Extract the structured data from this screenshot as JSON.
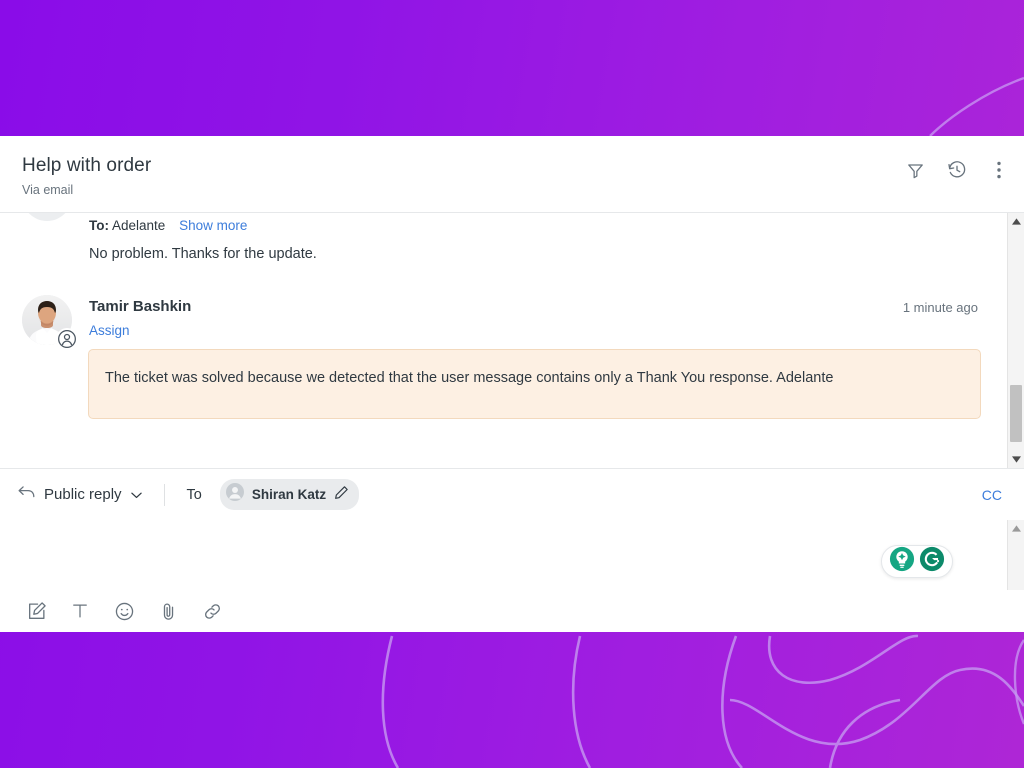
{
  "theme": {
    "bg_gradient_from": "#8A0CE8",
    "bg_gradient_to": "#AE26D6",
    "card_bg": "#FFFFFF",
    "link_color": "#3D7DDB",
    "text_primary": "#2F3941",
    "text_secondary": "#68737D",
    "note_bg": "#FDF0E3",
    "note_border": "#F3D9BD",
    "chip_bg": "#E9EBED",
    "grammarly_green": "#15A683",
    "grammarly_dark_green": "#0C8A6A"
  },
  "header": {
    "title": "Help with order",
    "subtitle": "Via email",
    "actions": [
      {
        "name": "filter-icon",
        "label": "Filter"
      },
      {
        "name": "history-icon",
        "label": "History"
      },
      {
        "name": "more-options-icon",
        "label": "More options"
      }
    ]
  },
  "conversation": {
    "messages": [
      {
        "id": "clipped-message",
        "to_label": "To:",
        "to_value": "Adelante",
        "show_more_label": "Show more",
        "body": "No problem. Thanks for the update."
      },
      {
        "id": "internal-note",
        "author": "Tamir Bashkin",
        "assign_label": "Assign",
        "timestamp": "1 minute ago",
        "note_body": "The ticket was solved because we detected that the user message contains only a Thank You response. Adelante"
      }
    ],
    "scrollbar": {
      "up_arrow": "▲",
      "down_arrow": "▼",
      "thumb_top_pct": 70,
      "thumb_height_pct": 26
    }
  },
  "reply": {
    "reply_icon": "reply-arrow-icon",
    "type_label": "Public reply",
    "chevron": "⌄",
    "to_label": "To",
    "recipient": {
      "name": "Shiran Katz",
      "avatar_icon": "person-avatar-icon",
      "edit_icon": "pencil-edit-icon"
    },
    "cc_label": "CC",
    "composer_placeholder": "",
    "composer_value": "",
    "scrollbar": {
      "up_arrow": "▲",
      "down_arrow": "▼"
    }
  },
  "grammarly": {
    "assistant_icon": "lightbulb-sparkle-icon",
    "logo_letter": "G",
    "logo_icon": "grammarly-logo-icon"
  },
  "format_toolbar": {
    "items": [
      {
        "name": "compose-edit-icon",
        "label": "Compose"
      },
      {
        "name": "text-format-icon",
        "label": "Text format"
      },
      {
        "name": "emoji-icon",
        "label": "Emoji"
      },
      {
        "name": "attachment-icon",
        "label": "Attach file"
      },
      {
        "name": "link-icon",
        "label": "Insert link"
      }
    ]
  }
}
